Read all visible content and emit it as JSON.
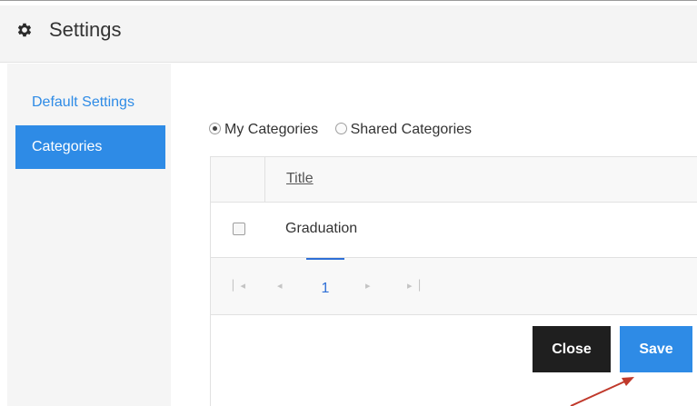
{
  "header": {
    "title": "Settings",
    "icon": "gear-icon"
  },
  "sidebar": {
    "items": [
      {
        "label": "Default Settings",
        "active": false
      },
      {
        "label": "Categories",
        "active": true
      }
    ]
  },
  "category_scope": {
    "options": [
      {
        "label": "My Categories",
        "checked": true
      },
      {
        "label": "Shared Categories",
        "checked": false
      }
    ]
  },
  "grid": {
    "columns": [
      "Title"
    ],
    "rows": [
      {
        "title": "Graduation",
        "selected": false
      }
    ]
  },
  "pager": {
    "current_page": "1",
    "first_icon": "first-page-icon",
    "prev_icon": "prev-page-icon",
    "next_icon": "next-page-icon",
    "last_icon": "last-page-icon"
  },
  "actions": {
    "close_label": "Close",
    "save_label": "Save"
  },
  "colors": {
    "accent": "#2e8be6",
    "close_button": "#1f1f1f",
    "annotation_arrow": "#c0392b"
  }
}
